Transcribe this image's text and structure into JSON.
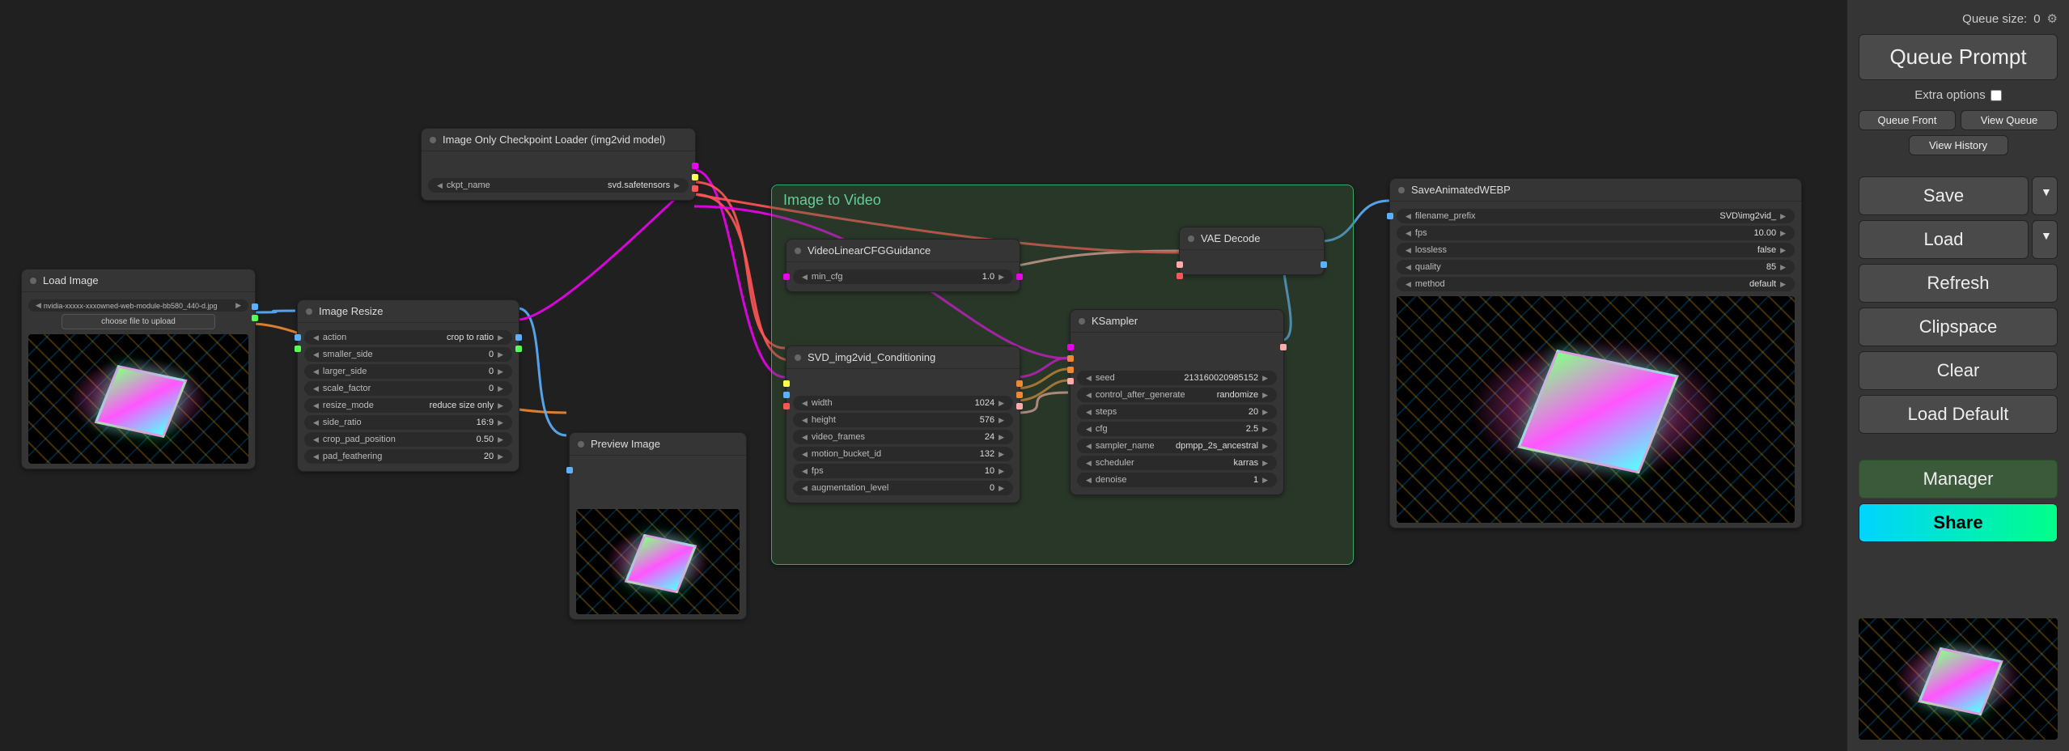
{
  "sidebar": {
    "queue_label": "Queue size:",
    "queue_size": "0",
    "queue_prompt": "Queue Prompt",
    "extra_options": "Extra options",
    "queue_front": "Queue Front",
    "view_queue": "View Queue",
    "view_history": "View History",
    "save": "Save",
    "load": "Load",
    "refresh": "Refresh",
    "clipspace": "Clipspace",
    "clear": "Clear",
    "load_default": "Load Default",
    "manager": "Manager",
    "share": "Share"
  },
  "group": {
    "title": "Image to Video"
  },
  "nodes": {
    "load_image": {
      "title": "Load Image",
      "filename": "nvidia-xxxxx-xxxowned-web-module-bb580_440-d.jpg",
      "upload": "choose file to upload"
    },
    "image_resize": {
      "title": "Image Resize",
      "params": [
        {
          "k": "action",
          "v": "crop to ratio"
        },
        {
          "k": "smaller_side",
          "v": "0"
        },
        {
          "k": "larger_side",
          "v": "0"
        },
        {
          "k": "scale_factor",
          "v": "0"
        },
        {
          "k": "resize_mode",
          "v": "reduce size only"
        },
        {
          "k": "side_ratio",
          "v": "16:9"
        },
        {
          "k": "crop_pad_position",
          "v": "0.50"
        },
        {
          "k": "pad_feathering",
          "v": "20"
        }
      ]
    },
    "ckpt_loader": {
      "title": "Image Only Checkpoint Loader (img2vid model)",
      "params": [
        {
          "k": "ckpt_name",
          "v": "svd.safetensors"
        }
      ]
    },
    "preview_image": {
      "title": "Preview Image"
    },
    "cfg_guidance": {
      "title": "VideoLinearCFGGuidance",
      "params": [
        {
          "k": "min_cfg",
          "v": "1.0"
        }
      ]
    },
    "svd_cond": {
      "title": "SVD_img2vid_Conditioning",
      "params": [
        {
          "k": "width",
          "v": "1024"
        },
        {
          "k": "height",
          "v": "576"
        },
        {
          "k": "video_frames",
          "v": "24"
        },
        {
          "k": "motion_bucket_id",
          "v": "132"
        },
        {
          "k": "fps",
          "v": "10"
        },
        {
          "k": "augmentation_level",
          "v": "0"
        }
      ]
    },
    "vae_decode": {
      "title": "VAE Decode"
    },
    "ksampler": {
      "title": "KSampler",
      "params": [
        {
          "k": "seed",
          "v": "213160020985152"
        },
        {
          "k": "control_after_generate",
          "v": "randomize"
        },
        {
          "k": "steps",
          "v": "20"
        },
        {
          "k": "cfg",
          "v": "2.5"
        },
        {
          "k": "sampler_name",
          "v": "dpmpp_2s_ancestral"
        },
        {
          "k": "scheduler",
          "v": "karras"
        },
        {
          "k": "denoise",
          "v": "1"
        }
      ]
    },
    "save_webp": {
      "title": "SaveAnimatedWEBP",
      "params": [
        {
          "k": "filename_prefix",
          "v": "SVD\\img2vid_"
        },
        {
          "k": "fps",
          "v": "10.00"
        },
        {
          "k": "lossless",
          "v": "false"
        },
        {
          "k": "quality",
          "v": "85"
        },
        {
          "k": "method",
          "v": "default"
        }
      ]
    }
  }
}
